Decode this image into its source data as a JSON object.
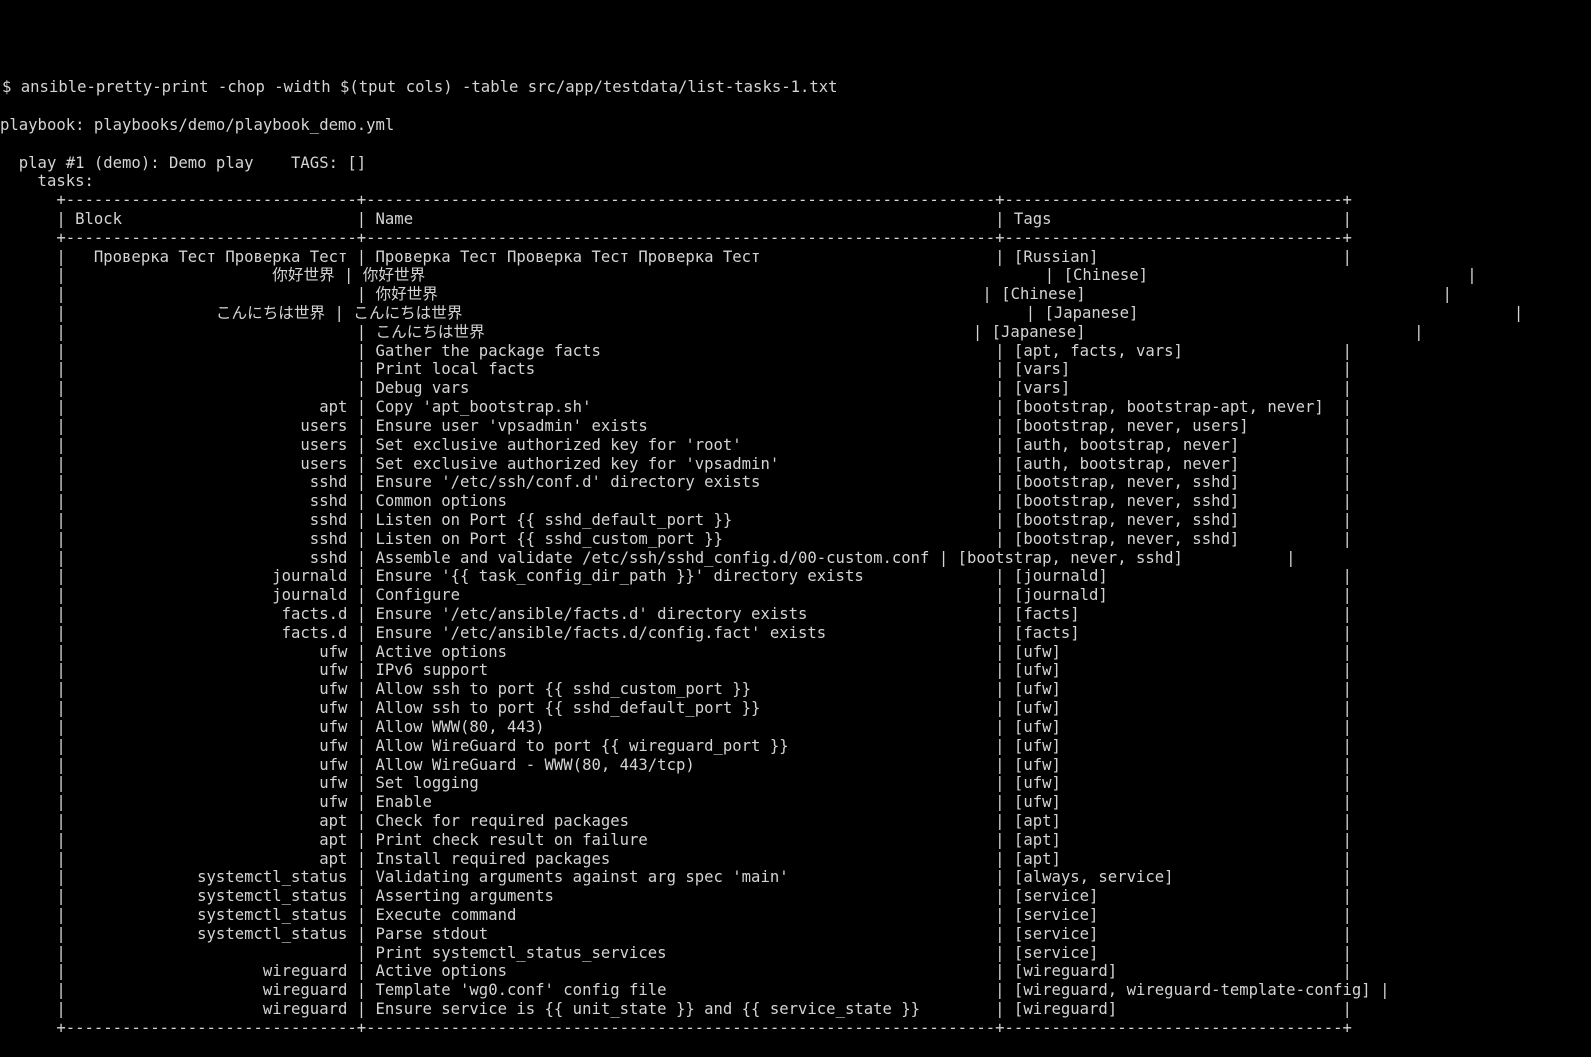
{
  "terminal": {
    "window_title": "Terminal — ansible-pretty-print",
    "background_color": "#000000",
    "foreground_color": "#d4d4d4",
    "prompt_symbol": "$",
    "command": "ansible-pretty-print -chop -width $(tput cols) -table src/app/testdata/list-tasks-1.txt",
    "prompt_line": "$ ansible-pretty-print -chop -width $(tput cols) -table src/app/testdata/list-tasks-1.txt"
  },
  "output": {
    "playbook_line": "playbook: playbooks/demo/playbook_demo.yml",
    "play_line": "  play #1 (demo): Demo play    TAGS: []",
    "tasks_label": "    tasks:",
    "play": {
      "number": "#1",
      "id": "demo",
      "name": "Demo play",
      "tags": "[]"
    },
    "playbook_path": "playbooks/demo/playbook_demo.yml"
  },
  "table": {
    "border_top": "      +-------------------------------+-------------------------------------------------------------------+------------------------------------+",
    "border_mid": "      +-------------------------------+-------------------------------------------------------------------+------------------------------------+",
    "border_bottom": "      +-------------------------------+-------------------------------------------------------------------+------------------------------------+",
    "header_row": "      | Block                         | Name                                                              | Tags                               |",
    "headers": [
      "Block",
      "Name",
      "Tags"
    ],
    "rows": [
      {
        "block": "Проверка Тест Проверка Тест",
        "name": "Проверка Тест Проверка Тест Проверка Тест",
        "tags": "[Russian]",
        "raw": "      |   Проверка Тест Проверка Тест | Проверка Тест Проверка Тест Проверка Тест                         | [Russian]                          |"
      },
      {
        "block": "你好世界",
        "name": "你好世界",
        "tags": "[Chinese]",
        "raw": "      |                      你好世界 | 你好世界                                                                  | [Chinese]                                  |"
      },
      {
        "block": "",
        "name": "你好世界",
        "tags": "[Chinese]",
        "raw": "      |                               | 你好世界                                                          | [Chinese]                                      |"
      },
      {
        "block": "こんにちは世界",
        "name": "こんにちは世界",
        "tags": "[Japanese]",
        "raw": "      |                こんにちは世界 | こんにちは世界                                                            | [Japanese]                                        |"
      },
      {
        "block": "",
        "name": "こんにちは世界",
        "tags": "[Japanese]",
        "raw": "      |                               | こんにちは世界                                                    | [Japanese]                                   |"
      },
      {
        "block": "",
        "name": "Gather the package facts",
        "tags": "[apt, facts, vars]"
      },
      {
        "block": "",
        "name": "Print local facts",
        "tags": "[vars]"
      },
      {
        "block": "",
        "name": "Debug vars",
        "tags": "[vars]"
      },
      {
        "block": "apt",
        "name": "Copy 'apt_bootstrap.sh'",
        "tags": "[bootstrap, bootstrap-apt, never]"
      },
      {
        "block": "users",
        "name": "Ensure user 'vpsadmin' exists",
        "tags": "[bootstrap, never, users]"
      },
      {
        "block": "users",
        "name": "Set exclusive authorized key for 'root'",
        "tags": "[auth, bootstrap, never]"
      },
      {
        "block": "users",
        "name": "Set exclusive authorized key for 'vpsadmin'",
        "tags": "[auth, bootstrap, never]"
      },
      {
        "block": "sshd",
        "name": "Ensure '/etc/ssh/conf.d' directory exists",
        "tags": "[bootstrap, never, sshd]"
      },
      {
        "block": "sshd",
        "name": "Common options",
        "tags": "[bootstrap, never, sshd]"
      },
      {
        "block": "sshd",
        "name": "Listen on Port {{ sshd_default_port }}",
        "tags": "[bootstrap, never, sshd]"
      },
      {
        "block": "sshd",
        "name": "Listen on Port {{ sshd_custom_port }}",
        "tags": "[bootstrap, never, sshd]"
      },
      {
        "block": "sshd",
        "name": "Assemble and validate /etc/ssh/sshd_config.d/00-custom.conf",
        "tags": "[bootstrap, never, sshd]"
      },
      {
        "block": "journald",
        "name": "Ensure '{{ task_config_dir_path }}' directory exists",
        "tags": "[journald]"
      },
      {
        "block": "journald",
        "name": "Configure",
        "tags": "[journald]"
      },
      {
        "block": "facts.d",
        "name": "Ensure '/etc/ansible/facts.d' directory exists",
        "tags": "[facts]"
      },
      {
        "block": "facts.d",
        "name": "Ensure '/etc/ansible/facts.d/config.fact' exists",
        "tags": "[facts]"
      },
      {
        "block": "ufw",
        "name": "Active options",
        "tags": "[ufw]"
      },
      {
        "block": "ufw",
        "name": "IPv6 support",
        "tags": "[ufw]"
      },
      {
        "block": "ufw",
        "name": "Allow ssh to port {{ sshd_custom_port }}",
        "tags": "[ufw]"
      },
      {
        "block": "ufw",
        "name": "Allow ssh to port {{ sshd_default_port }}",
        "tags": "[ufw]"
      },
      {
        "block": "ufw",
        "name": "Allow WWW(80, 443)",
        "tags": "[ufw]"
      },
      {
        "block": "ufw",
        "name": "Allow WireGuard to port {{ wireguard_port }}",
        "tags": "[ufw]"
      },
      {
        "block": "ufw",
        "name": "Allow WireGuard - WWW(80, 443/tcp)",
        "tags": "[ufw]"
      },
      {
        "block": "ufw",
        "name": "Set logging",
        "tags": "[ufw]"
      },
      {
        "block": "ufw",
        "name": "Enable",
        "tags": "[ufw]"
      },
      {
        "block": "apt",
        "name": "Check for required packages",
        "tags": "[apt]"
      },
      {
        "block": "apt",
        "name": "Print check result on failure",
        "tags": "[apt]"
      },
      {
        "block": "apt",
        "name": "Install required packages",
        "tags": "[apt]"
      },
      {
        "block": "systemctl_status",
        "name": "Validating arguments against arg spec 'main'",
        "tags": "[always, service]"
      },
      {
        "block": "systemctl_status",
        "name": "Asserting arguments",
        "tags": "[service]"
      },
      {
        "block": "systemctl_status",
        "name": "Execute command",
        "tags": "[service]"
      },
      {
        "block": "systemctl_status",
        "name": "Parse stdout",
        "tags": "[service]"
      },
      {
        "block": "",
        "name": "Print systemctl_status_services",
        "tags": "[service]"
      },
      {
        "block": "wireguard",
        "name": "Active options",
        "tags": "[wireguard]"
      },
      {
        "block": "wireguard",
        "name": "Template 'wg0.conf' config file",
        "tags": "[wireguard, wireguard-template-config]"
      },
      {
        "block": "wireguard",
        "name": "Ensure service is {{ unit_state }} and {{ service_state }}",
        "tags": "[wireguard]"
      }
    ]
  },
  "render": {
    "lines": [
      "$ ansible-pretty-print -chop -width $(tput cols) -table src/app/testdata/list-tasks-1.txt",
      "",
      "playbook: playbooks/demo/playbook_demo.yml",
      "",
      "  play #1 (demo): Demo play    TAGS: []",
      "    tasks:",
      "      +-------------------------------+-------------------------------------------------------------------+------------------------------------+",
      "      | Block                         | Name                                                              | Tags                               |",
      "      +-------------------------------+-------------------------------------------------------------------+------------------------------------+",
      "      |   Проверка Тест Проверка Тест | Проверка Тест Проверка Тест Проверка Тест                         | [Russian]                          |",
      "      |                      你好世界 | 你好世界                                                                  | [Chinese]                                  |",
      "      |                               | 你好世界                                                          | [Chinese]                                      |",
      "      |                こんにちは世界 | こんにちは世界                                                            | [Japanese]                                        |",
      "      |                               | こんにちは世界                                                    | [Japanese]                                   |",
      "      |                               | Gather the package facts                                          | [apt, facts, vars]                 |",
      "      |                               | Print local facts                                                 | [vars]                             |",
      "      |                               | Debug vars                                                        | [vars]                             |",
      "      |                           apt | Copy 'apt_bootstrap.sh'                                           | [bootstrap, bootstrap-apt, never]  |",
      "      |                         users | Ensure user 'vpsadmin' exists                                     | [bootstrap, never, users]          |",
      "      |                         users | Set exclusive authorized key for 'root'                           | [auth, bootstrap, never]           |",
      "      |                         users | Set exclusive authorized key for 'vpsadmin'                       | [auth, bootstrap, never]           |",
      "      |                          sshd | Ensure '/etc/ssh/conf.d' directory exists                         | [bootstrap, never, sshd]           |",
      "      |                          sshd | Common options                                                    | [bootstrap, never, sshd]           |",
      "      |                          sshd | Listen on Port {{ sshd_default_port }}                            | [bootstrap, never, sshd]           |",
      "      |                          sshd | Listen on Port {{ sshd_custom_port }}                             | [bootstrap, never, sshd]           |",
      "      |                          sshd | Assemble and validate /etc/ssh/sshd_config.d/00-custom.conf | [bootstrap, never, sshd]           |",
      "      |                      journald | Ensure '{{ task_config_dir_path }}' directory exists              | [journald]                         |",
      "      |                      journald | Configure                                                         | [journald]                         |",
      "      |                       facts.d | Ensure '/etc/ansible/facts.d' directory exists                    | [facts]                            |",
      "      |                       facts.d | Ensure '/etc/ansible/facts.d/config.fact' exists                  | [facts]                            |",
      "      |                           ufw | Active options                                                    | [ufw]                              |",
      "      |                           ufw | IPv6 support                                                      | [ufw]                              |",
      "      |                           ufw | Allow ssh to port {{ sshd_custom_port }}                          | [ufw]                              |",
      "      |                           ufw | Allow ssh to port {{ sshd_default_port }}                         | [ufw]                              |",
      "      |                           ufw | Allow WWW(80, 443)                                                | [ufw]                              |",
      "      |                           ufw | Allow WireGuard to port {{ wireguard_port }}                      | [ufw]                              |",
      "      |                           ufw | Allow WireGuard - WWW(80, 443/tcp)                                | [ufw]                              |",
      "      |                           ufw | Set logging                                                       | [ufw]                              |",
      "      |                           ufw | Enable                                                            | [ufw]                              |",
      "      |                           apt | Check for required packages                                       | [apt]                              |",
      "      |                           apt | Print check result on failure                                     | [apt]                              |",
      "      |                           apt | Install required packages                                         | [apt]                              |",
      "      |              systemctl_status | Validating arguments against arg spec 'main'                      | [always, service]                  |",
      "      |              systemctl_status | Asserting arguments                                               | [service]                          |",
      "      |              systemctl_status | Execute command                                                   | [service]                          |",
      "      |              systemctl_status | Parse stdout                                                      | [service]                          |",
      "      |                               | Print systemctl_status_services                                   | [service]                          |",
      "      |                     wireguard | Active options                                                    | [wireguard]                        |",
      "      |                     wireguard | Template 'wg0.conf' config file                                   | [wireguard, wireguard-template-config] |",
      "      |                     wireguard | Ensure service is {{ unit_state }} and {{ service_state }}        | [wireguard]                        |",
      "      +-------------------------------+-------------------------------------------------------------------+------------------------------------+"
    ]
  }
}
